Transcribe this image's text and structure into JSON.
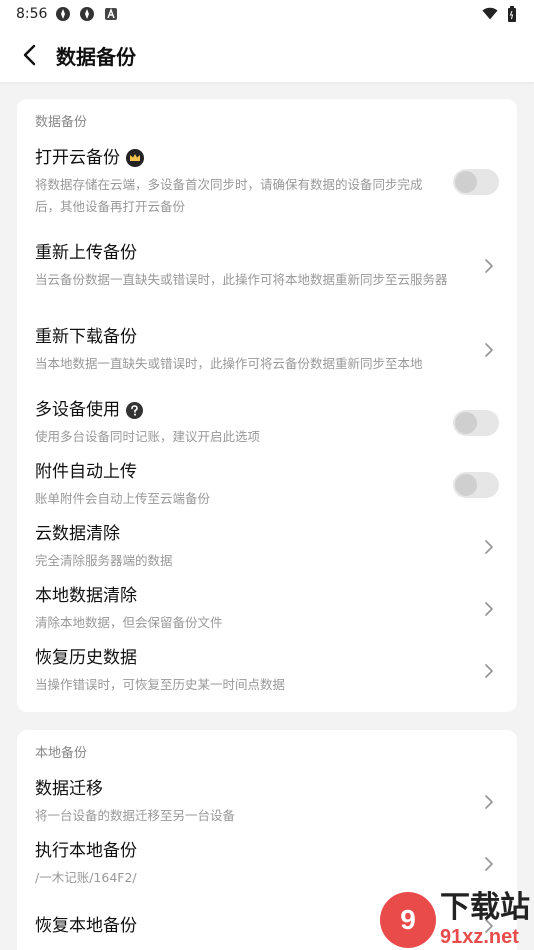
{
  "status_bar": {
    "time": "8:56"
  },
  "header": {
    "title": "数据备份"
  },
  "sections": [
    {
      "title": "数据备份",
      "items": [
        {
          "title": "打开云备份",
          "desc": "将数据存储在云端，多设备首次同步时，请确保有数据的设备同步完成后，其他设备再打开云备份",
          "control": "toggle",
          "enabled": false
        },
        {
          "title": "重新上传备份",
          "desc": "当云备份数据一直缺失或错误时，此操作可将本地数据重新同步至云服务器",
          "control": "chevron"
        },
        {
          "title": "重新下载备份",
          "desc": "当本地数据一直缺失或错误时，此操作可将云备份数据重新同步至本地",
          "control": "chevron"
        },
        {
          "title": "多设备使用",
          "desc": "使用多台设备同时记账，建议开启此选项",
          "control": "toggle",
          "enabled": false
        },
        {
          "title": "附件自动上传",
          "desc": "账单附件会自动上传至云端备份",
          "control": "toggle",
          "enabled": false
        },
        {
          "title": "云数据清除",
          "desc": "完全清除服务器端的数据",
          "control": "chevron"
        },
        {
          "title": "本地数据清除",
          "desc": "清除本地数据，但会保留备份文件",
          "control": "chevron"
        },
        {
          "title": "恢复历史数据",
          "desc": "当操作错误时，可恢复至历史某一时间点数据",
          "control": "chevron"
        }
      ]
    },
    {
      "title": "本地备份",
      "items": [
        {
          "title": "数据迁移",
          "desc": "将一台设备的数据迁移至另一台设备",
          "control": "chevron"
        },
        {
          "title": "执行本地备份",
          "desc": "/一木记账/164F2/",
          "control": "chevron"
        },
        {
          "title": "恢复本地备份",
          "desc": "",
          "control": "chevron"
        }
      ]
    }
  ],
  "watermark": {
    "logo_text": "9",
    "title": "下载站",
    "subtitle": "91xz.net"
  },
  "colors": {
    "background": "#f3f3f3",
    "card": "#ffffff",
    "toggle_off": "#e6e6e6",
    "watermark_red": "#e94b4b"
  },
  "icons": {
    "status_left": [
      "app-icon",
      "app-icon",
      "a-icon"
    ],
    "status_right": [
      "wifi-icon",
      "battery-icon"
    ],
    "back": "back-arrow-icon",
    "crown": "crown-icon",
    "help": "help-circle-icon",
    "chevron": "chevron-right-icon"
  }
}
